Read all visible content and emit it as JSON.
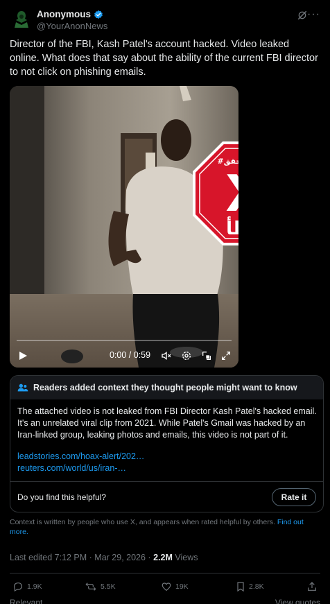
{
  "author": {
    "name": "Anonymous",
    "handle": "@YourAnonNews",
    "verified_color": "#1d9bf0"
  },
  "tweet_text": "Director of the FBI, Kash Patel's account hacked. Video leaked online. What does that say about the ability of the current FBI director to not click on phishing emails.",
  "video": {
    "timecode": "0:00 / 0:59",
    "overlay_stamp": {
      "top_text": "#النهار_تتحقق",
      "letter": "X",
      "bottom_text": "خطأ",
      "color": "#d7152a"
    }
  },
  "community_note": {
    "heading": "Readers added context they thought people might want to know",
    "body": "The attached video is not leaked from FBI Director Kash Patel's hacked email. It's an unrelated viral clip from 2021. While Patel's Gmail was hacked by an Iran-linked group, leaking photos and emails, this video is not part of it.",
    "links": [
      "leadstories.com/hoax-alert/202…",
      "reuters.com/world/us/iran-…"
    ],
    "helpful_question": "Do you find this helpful?",
    "rate_label": "Rate it"
  },
  "context_text": "Context is written by people who use X, and appears when rated helpful by others.",
  "find_out_more": "Find out more.",
  "meta": {
    "edited": "Last edited 7:12 PM · Mar 29, 2026 ·",
    "views_count": "2.2M",
    "views_label": "Views"
  },
  "actions": {
    "replies": "1.9K",
    "reposts": "5.5K",
    "likes": "19K",
    "bookmarks": "2.8K"
  },
  "bottom_bar": {
    "left": "Relevant",
    "right": "View quotes"
  },
  "colors": {
    "background": "#000000",
    "text": "#e7e9ea",
    "muted": "#71767b",
    "link": "#1d9bf0",
    "border": "#2f3336"
  }
}
